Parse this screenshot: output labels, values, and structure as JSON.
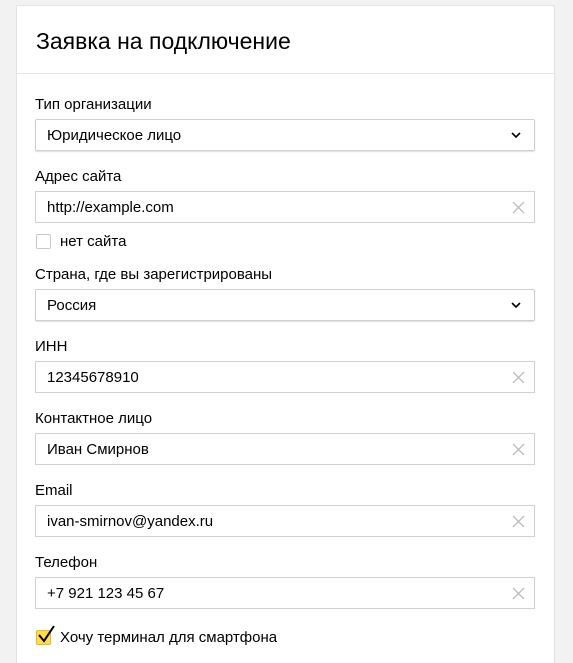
{
  "form": {
    "title": "Заявка на подключение",
    "org_type": {
      "label": "Тип организации",
      "value": "Юридическое лицо"
    },
    "site": {
      "label": "Адрес сайта",
      "value": "http://example.com",
      "no_site_label": "нет сайта",
      "no_site_checked": false
    },
    "country": {
      "label": "Страна, где вы зарегистрированы",
      "value": "Россия"
    },
    "inn": {
      "label": "ИНН",
      "value": "12345678910"
    },
    "contact": {
      "label": "Контактное лицо",
      "value": "Иван Смирнов"
    },
    "email": {
      "label": "Email",
      "value": "ivan-smirnov@yandex.ru"
    },
    "phone": {
      "label": "Телефон",
      "value": "+7 921 123 45 67"
    },
    "terminal": {
      "label": "Хочу терминал для смартфона",
      "checked": true
    }
  },
  "colors": {
    "page_bg": "#f2f2f2",
    "card_bg": "#ffffff",
    "border": "#d0d0d0",
    "checkbox_accent": "#ffdb4d",
    "clear_icon": "#bdbdbd"
  }
}
